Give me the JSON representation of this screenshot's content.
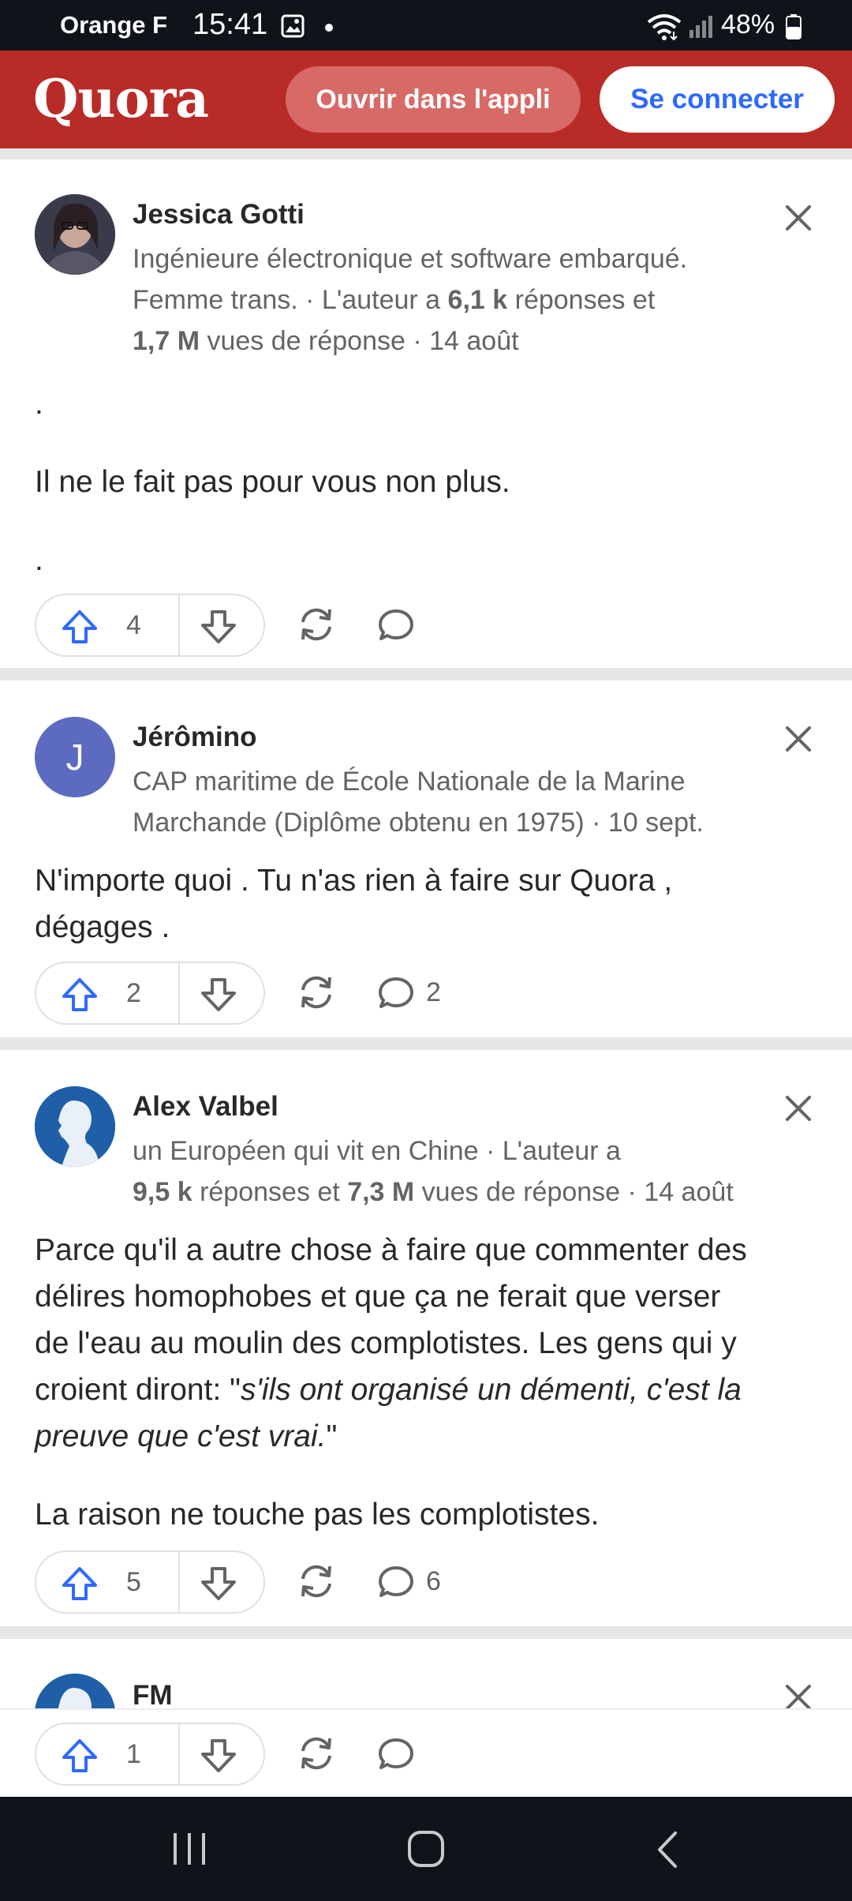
{
  "status_bar": {
    "carrier": "Orange F",
    "time": "15:41",
    "battery": "48%"
  },
  "header": {
    "logo": "Quora",
    "open_app_label": "Ouvrir dans l'appli",
    "login_label": "Se connecter"
  },
  "posts": [
    {
      "author": "Jessica Gotti",
      "meta_line1": "Ingénieure électronique et software embarqué.",
      "meta_line2_pre": "Femme trans. · L'auteur a ",
      "meta_line2_bold": "6,1 k",
      "meta_line2_post": " réponses et",
      "meta_line3_bold": "1,7 M",
      "meta_line3_post": " vues de réponse · 14 août",
      "body": [
        ".",
        "Il ne le fait pas pour vous non plus.",
        "."
      ],
      "upvotes": "4",
      "comments": ""
    },
    {
      "author": "Jérômino",
      "avatar_letter": "J",
      "meta_line1": "CAP maritime de École Nationale de la Marine",
      "meta_line2": "Marchande (Diplôme obtenu en 1975) · 10 sept.",
      "body_line1": "N'importe quoi . Tu n'as rien à faire sur Quora ,",
      "body_line2": "dégages .",
      "upvotes": "2",
      "comments": "2"
    },
    {
      "author": "Alex Valbel",
      "meta_line1": "un Européen qui vit en Chine · L'auteur a",
      "meta_line2_bold1": "9,5 k",
      "meta_line2_mid": " réponses et ",
      "meta_line2_bold2": "7,3 M",
      "meta_line2_post": " vues de réponse · 14 août",
      "body_l1": "Parce qu'il a autre chose à faire que commenter des",
      "body_l2": "délires homophobes et que ça ne ferait que verser",
      "body_l3": "de l'eau au moulin des complotistes. Les gens qui y",
      "body_l4_pre": "croient diront: \"",
      "body_l4_italic": "s'ils ont organisé un démenti, c'est la",
      "body_l5_italic": "preuve que c'est vrai.",
      "body_l5_post": "\"",
      "body_p2": "La raison ne touche pas les complotistes.",
      "upvotes": "5",
      "comments": "6"
    },
    {
      "author": "FM",
      "upvotes": "1"
    }
  ],
  "colors": {
    "brand_red": "#b92b27",
    "accent_blue": "#2e69ff",
    "avatar_purple": "#5c6bc0",
    "avatar_blue": "#1e5fa8"
  }
}
